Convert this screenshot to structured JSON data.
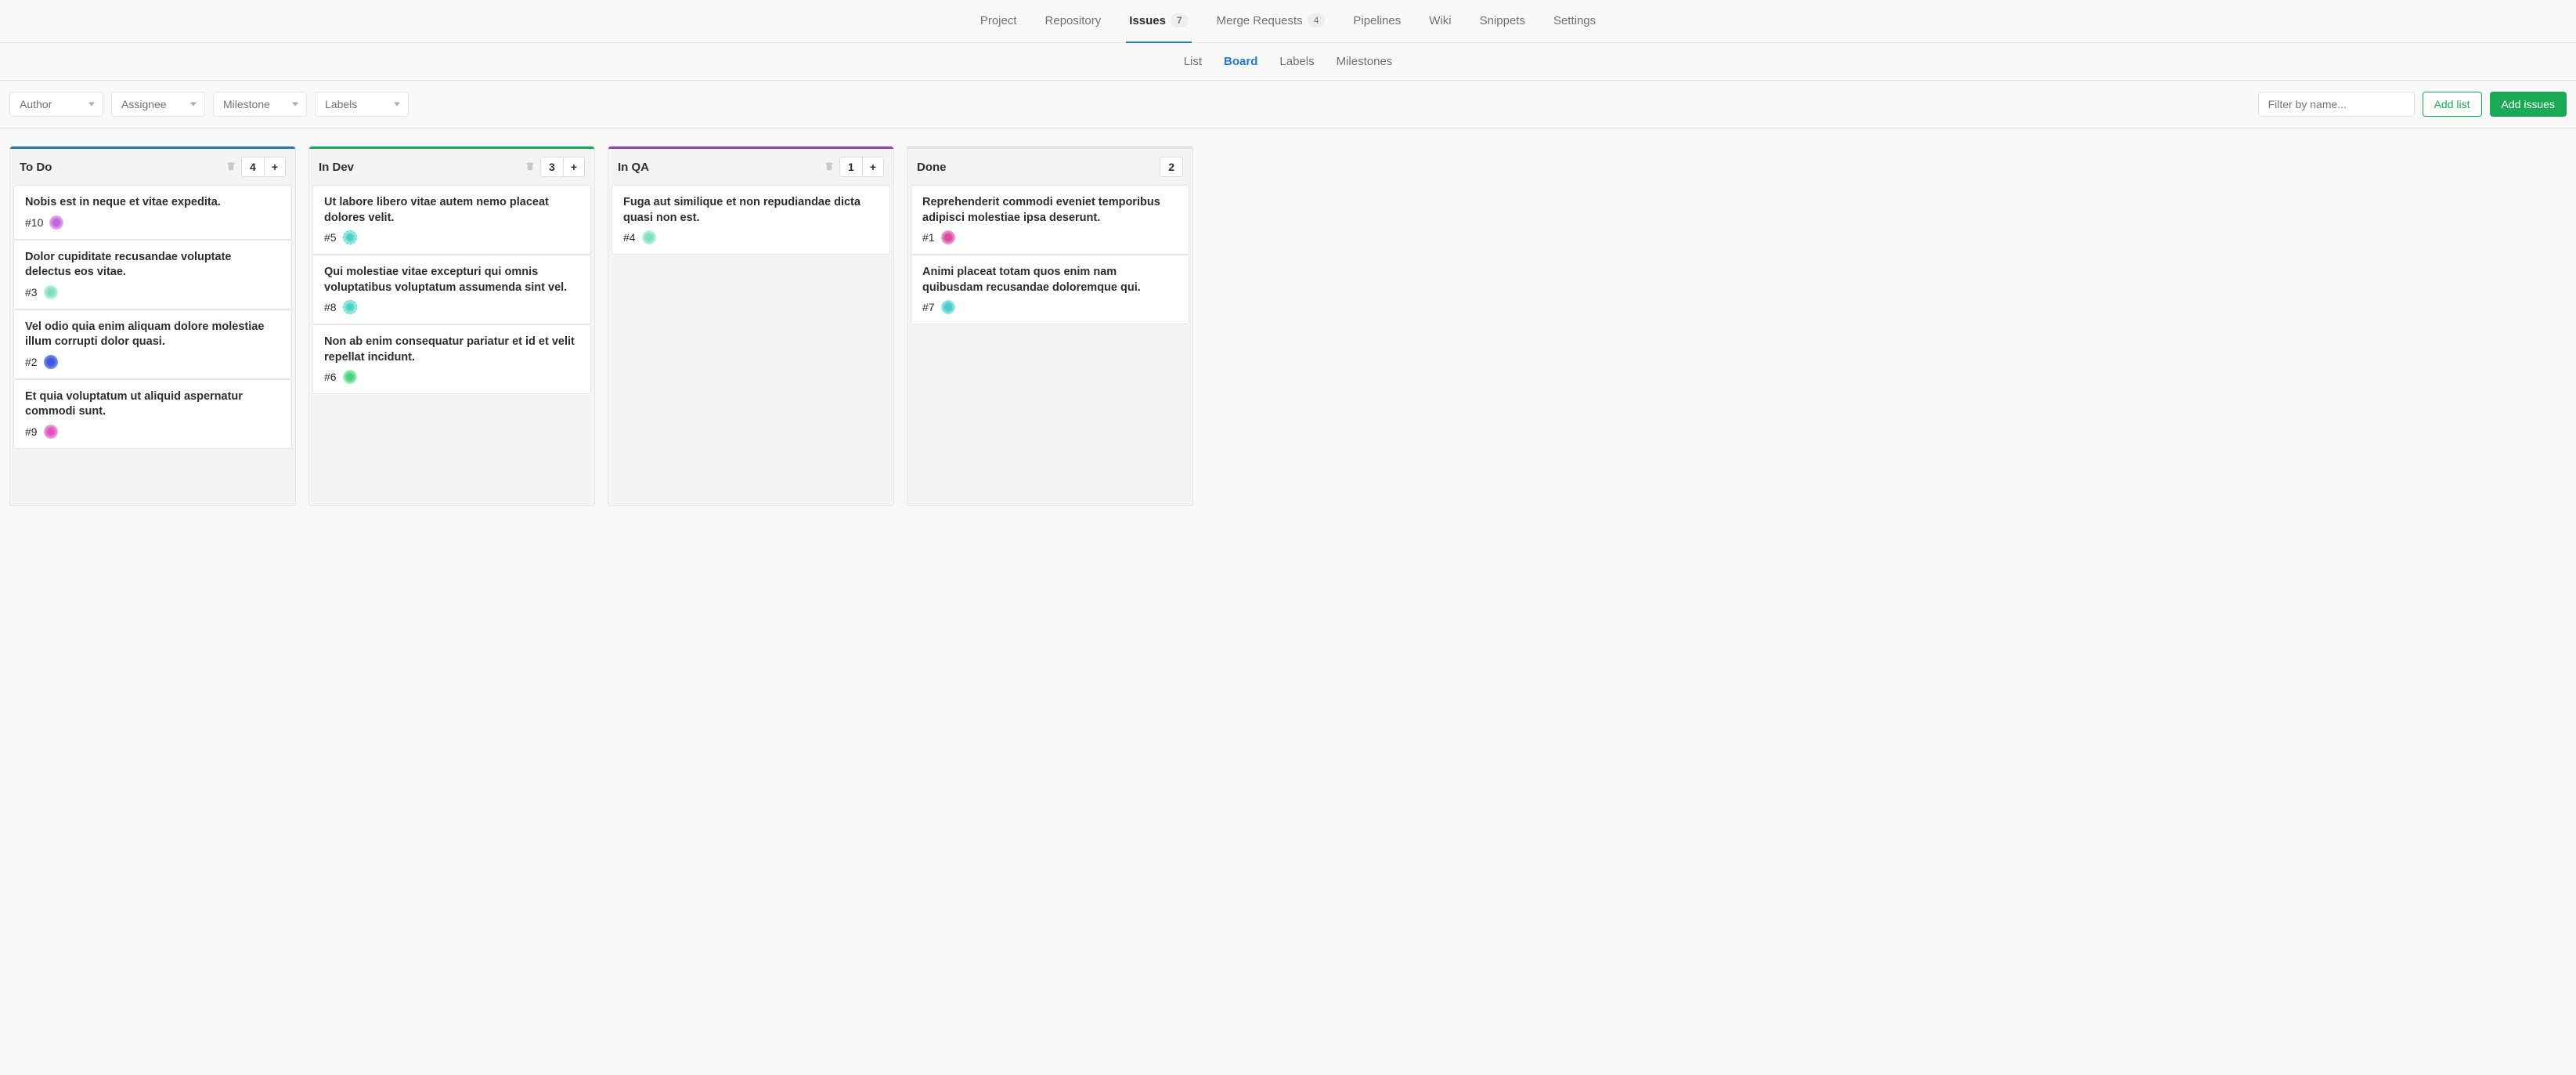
{
  "nav_primary": [
    {
      "label": "Project",
      "badge": null,
      "active": false
    },
    {
      "label": "Repository",
      "badge": null,
      "active": false
    },
    {
      "label": "Issues",
      "badge": "7",
      "active": true
    },
    {
      "label": "Merge Requests",
      "badge": "4",
      "active": false
    },
    {
      "label": "Pipelines",
      "badge": null,
      "active": false
    },
    {
      "label": "Wiki",
      "badge": null,
      "active": false
    },
    {
      "label": "Snippets",
      "badge": null,
      "active": false
    },
    {
      "label": "Settings",
      "badge": null,
      "active": false
    }
  ],
  "nav_secondary": [
    {
      "label": "List",
      "active": false
    },
    {
      "label": "Board",
      "active": true
    },
    {
      "label": "Labels",
      "active": false
    },
    {
      "label": "Milestones",
      "active": false
    }
  ],
  "filters": {
    "author": "Author",
    "assignee": "Assignee",
    "milestone": "Milestone",
    "labels": "Labels",
    "search_placeholder": "Filter by name...",
    "add_list": "Add list",
    "add_issues": "Add issues"
  },
  "lists": [
    {
      "title": "To Do",
      "color": "#1f78d1",
      "count": "4",
      "has_trash": true,
      "has_plus": true,
      "cards": [
        {
          "title": "Nobis est in neque et vitae expedita.",
          "id": "#10",
          "avatar": "purple"
        },
        {
          "title": "Dolor cupiditate recusandae voluptate delectus eos vitae.",
          "id": "#3",
          "avatar": "mint"
        },
        {
          "title": "Vel odio quia enim aliquam dolore molestiae illum corrupti dolor quasi.",
          "id": "#2",
          "avatar": "blue"
        },
        {
          "title": "Et quia voluptatum ut aliquid aspernatur commodi sunt.",
          "id": "#9",
          "avatar": "pink"
        }
      ]
    },
    {
      "title": "In Dev",
      "color": "#1aaa55",
      "count": "3",
      "has_trash": true,
      "has_plus": true,
      "cards": [
        {
          "title": "Ut labore libero vitae autem nemo placeat dolores velit.",
          "id": "#5",
          "avatar": "teal"
        },
        {
          "title": "Qui molestiae vitae excepturi qui omnis voluptatibus voluptatum assumenda sint vel.",
          "id": "#8",
          "avatar": "teal"
        },
        {
          "title": "Non ab enim consequatur pariatur et id et velit repellat incidunt.",
          "id": "#6",
          "avatar": "green"
        }
      ]
    },
    {
      "title": "In QA",
      "color": "#8e44ad",
      "count": "1",
      "has_trash": true,
      "has_plus": true,
      "cards": [
        {
          "title": "Fuga aut similique et non repudiandae dicta quasi non est.",
          "id": "#4",
          "avatar": "mint"
        }
      ]
    },
    {
      "title": "Done",
      "color": "#e5e5e5",
      "count": "2",
      "has_trash": false,
      "has_plus": false,
      "cards": [
        {
          "title": "Reprehenderit commodi eveniet temporibus adipisci molestiae ipsa deserunt.",
          "id": "#1",
          "avatar": "magenta"
        },
        {
          "title": "Animi placeat totam quos enim nam quibusdam recusandae doloremque qui.",
          "id": "#7",
          "avatar": "cyan"
        }
      ]
    }
  ]
}
